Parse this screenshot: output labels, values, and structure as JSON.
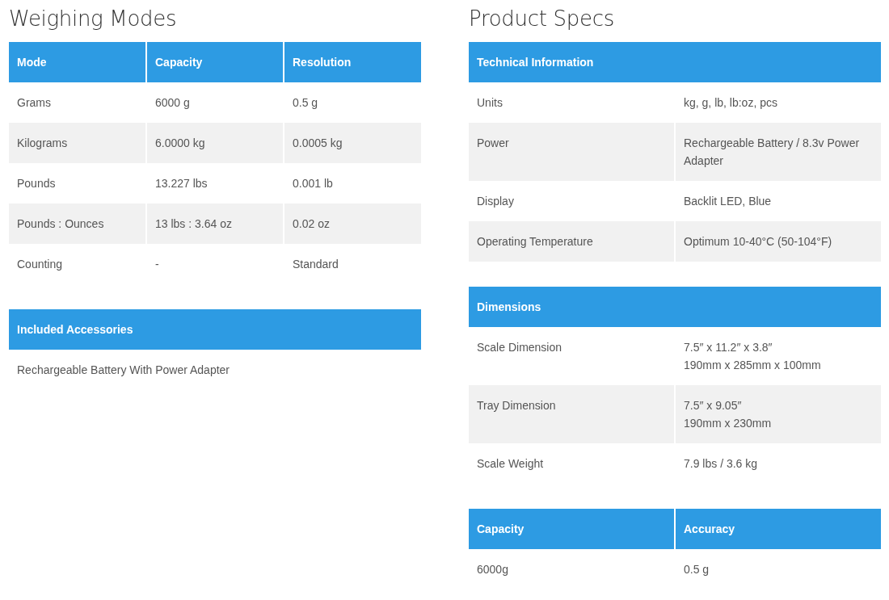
{
  "weighing_modes": {
    "title": "Weighing Modes",
    "tables": [
      {
        "columns": [
          "Mode",
          "Capacity",
          "Resolution"
        ],
        "rows": [
          [
            "Grams",
            "6000 g",
            "0.5 g"
          ],
          [
            "Kilograms",
            "6.0000 kg",
            "0.0005 kg"
          ],
          [
            "Pounds",
            "13.227 lbs",
            "0.001 lb"
          ],
          [
            "Pounds : Ounces",
            "13 lbs : 3.64 oz",
            "0.02 oz"
          ],
          [
            "Counting",
            "-",
            "Standard"
          ]
        ]
      },
      {
        "header": "Included Accessories",
        "rows": [
          [
            "Rechargeable Battery With Power Adapter"
          ]
        ]
      }
    ]
  },
  "product_specs": {
    "title": "Product Specs",
    "tables": [
      {
        "header": "Technical Information",
        "rows": [
          [
            "Units",
            "kg, g, lb, lb:oz, pcs"
          ],
          [
            "Power",
            "Rechargeable Battery / 8.3v Power Adapter"
          ],
          [
            "Display",
            "Backlit LED, Blue"
          ],
          [
            "Operating Temperature",
            "Optimum 10-40°C (50-104°F)"
          ]
        ]
      },
      {
        "header": "Dimensions",
        "rows": [
          [
            "Scale Dimension",
            "7.5″ x 11.2″ x 3.8″\n190mm x 285mm x 100mm"
          ],
          [
            "Tray Dimension",
            "7.5″ x 9.05″\n190mm x 230mm"
          ],
          [
            "Scale Weight",
            "7.9 lbs / 3.6 kg"
          ]
        ]
      },
      {
        "columns": [
          "Capacity",
          "Accuracy"
        ],
        "rows": [
          [
            "6000g",
            "0.5 g"
          ]
        ]
      }
    ]
  }
}
